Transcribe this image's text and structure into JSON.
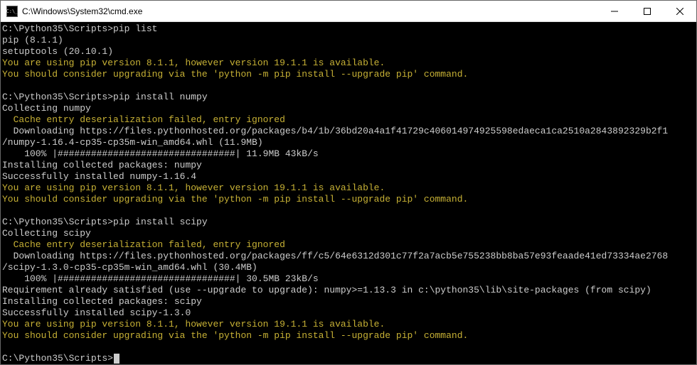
{
  "window": {
    "title": "C:\\Windows\\System32\\cmd.exe",
    "icon_label": "C:\\_"
  },
  "terminal": {
    "prompt_path": "C:\\Python35\\Scripts>",
    "commands": {
      "cmd1": "pip list",
      "cmd2": "pip install numpy",
      "cmd3": "pip install scipy"
    },
    "out": {
      "pip_ver": "pip (8.1.1)",
      "setuptools_ver": "setuptools (20.10.1)",
      "warn_ver": "You are using pip version 8.1.1, however version 19.1.1 is available.",
      "warn_upgrade": "You should consider upgrading via the 'python -m pip install --upgrade pip' command.",
      "collect_numpy": "Collecting numpy",
      "collect_scipy": "Collecting scipy",
      "cache_warn": "  Cache entry deserialization failed, entry ignored",
      "dl_numpy1": "  Downloading https://files.pythonhosted.org/packages/b4/1b/36bd20a4a1f41729c406014974925598edaeca1ca2510a2843892329b2f1",
      "dl_numpy2": "/numpy-1.16.4-cp35-cp35m-win_amd64.whl (11.9MB)",
      "progress_numpy": "    100% |################################| 11.9MB 43kB/s",
      "install_numpy": "Installing collected packages: numpy",
      "success_numpy": "Successfully installed numpy-1.16.4",
      "dl_scipy1": "  Downloading https://files.pythonhosted.org/packages/ff/c5/64e6312d301c77f2a7acb5e755238bb8ba57e93feaade41ed73334ae2768",
      "dl_scipy2": "/scipy-1.3.0-cp35-cp35m-win_amd64.whl (30.4MB)",
      "progress_scipy": "    100% |################################| 30.5MB 23kB/s",
      "req_satisfied": "Requirement already satisfied (use --upgrade to upgrade): numpy>=1.13.3 in c:\\python35\\lib\\site-packages (from scipy)",
      "install_scipy": "Installing collected packages: scipy",
      "success_scipy": "Successfully installed scipy-1.3.0"
    }
  }
}
